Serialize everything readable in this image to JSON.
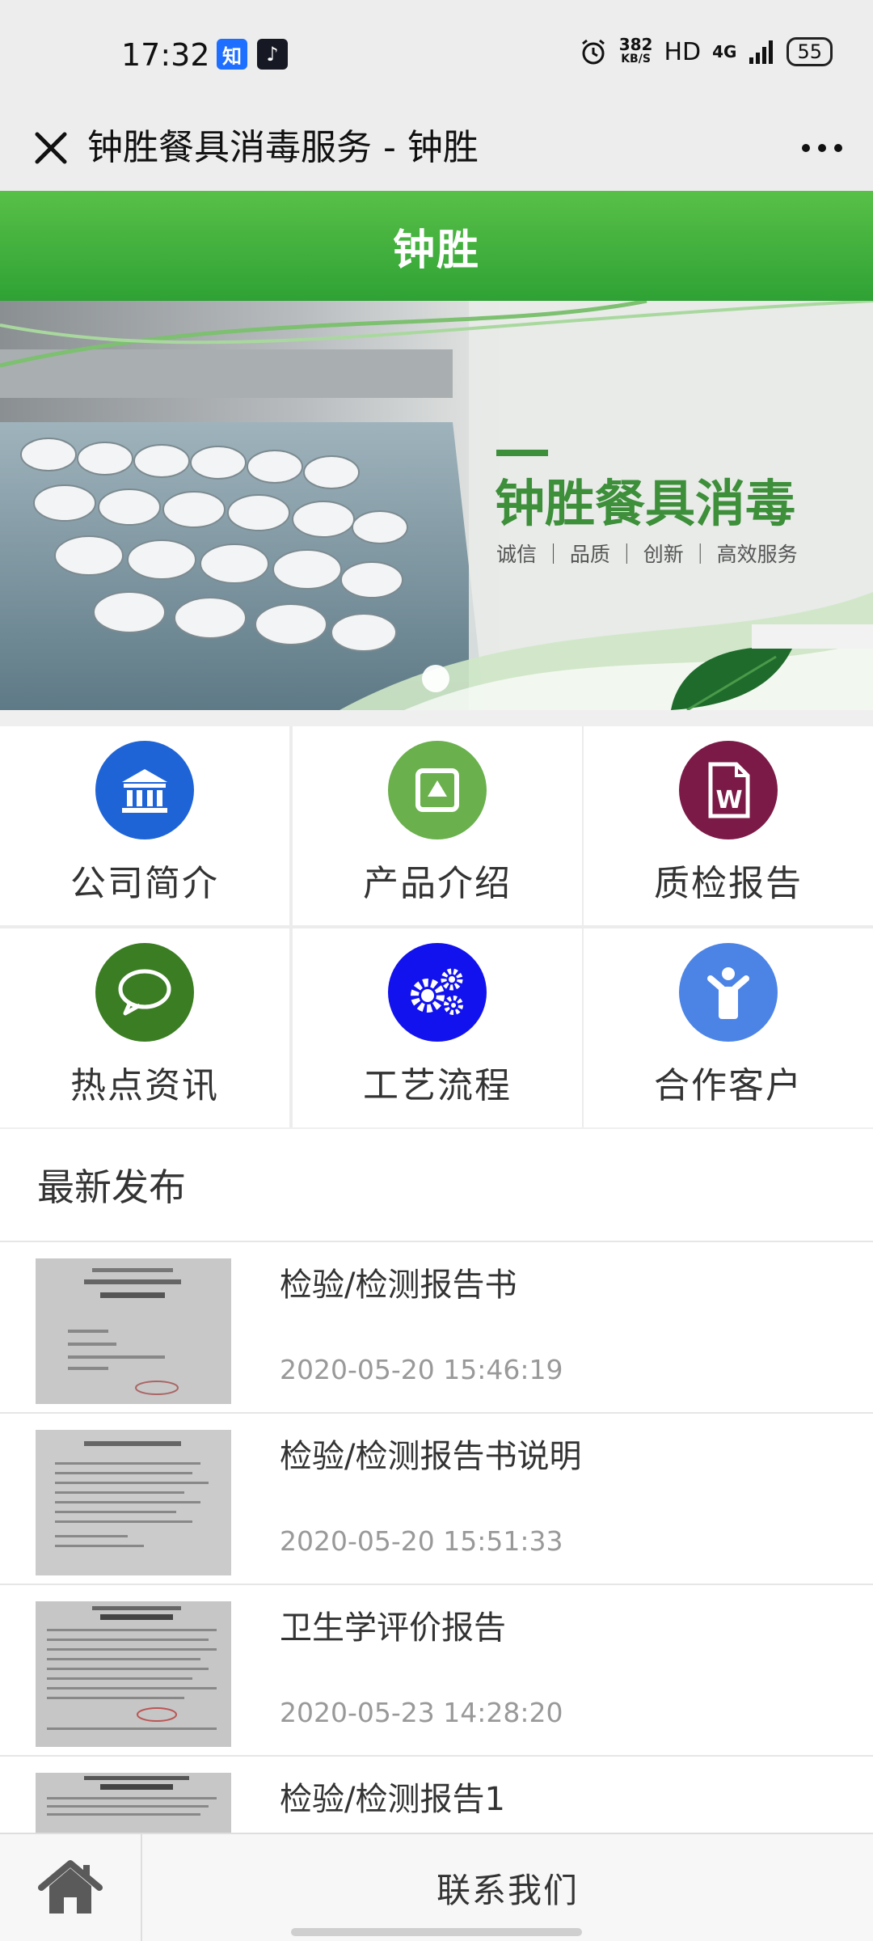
{
  "status_bar": {
    "time": "17:32",
    "app_icons": [
      {
        "label": "知",
        "color": "#1e6fff"
      },
      {
        "label": "♪",
        "color": "#161823"
      }
    ],
    "speed_value": "382",
    "speed_unit": "KB/S",
    "hd": "HD",
    "network": "4G",
    "battery": "55"
  },
  "nav": {
    "title": "钟胜餐具消毒服务 - 钟胜"
  },
  "header": {
    "title": "钟胜"
  },
  "banner": {
    "title": "钟胜餐具消毒",
    "subtitle": "诚信 ｜ 品质 ｜ 创新 ｜ 高效服务"
  },
  "menu": {
    "items": [
      {
        "label": "公司简介",
        "icon": "bank-icon",
        "color": "#1f64d6"
      },
      {
        "label": "产品介绍",
        "icon": "image-icon",
        "color": "#6ab04c"
      },
      {
        "label": "质检报告",
        "icon": "word-doc-icon",
        "color": "#7b1a46"
      },
      {
        "label": "热点资讯",
        "icon": "chat-bubble-icon",
        "color": "#3b7d23"
      },
      {
        "label": "工艺流程",
        "icon": "gears-icon",
        "color": "#1212ee"
      },
      {
        "label": "合作客户",
        "icon": "person-icon",
        "color": "#4c84e6"
      }
    ]
  },
  "latest": {
    "heading": "最新发布",
    "items": [
      {
        "title": "检验/检测报告书",
        "time": "2020-05-20 15:46:19"
      },
      {
        "title": "检验/检测报告书说明",
        "time": "2020-05-20 15:51:33"
      },
      {
        "title": "卫生学评价报告",
        "time": "2020-05-23 14:28:20"
      },
      {
        "title": "检验/检测报告1",
        "time": ""
      }
    ]
  },
  "bottom_bar": {
    "contact_label": "联系我们"
  },
  "colors": {
    "header_green": "#3aac3a",
    "brand_green": "#3d8f3a"
  }
}
